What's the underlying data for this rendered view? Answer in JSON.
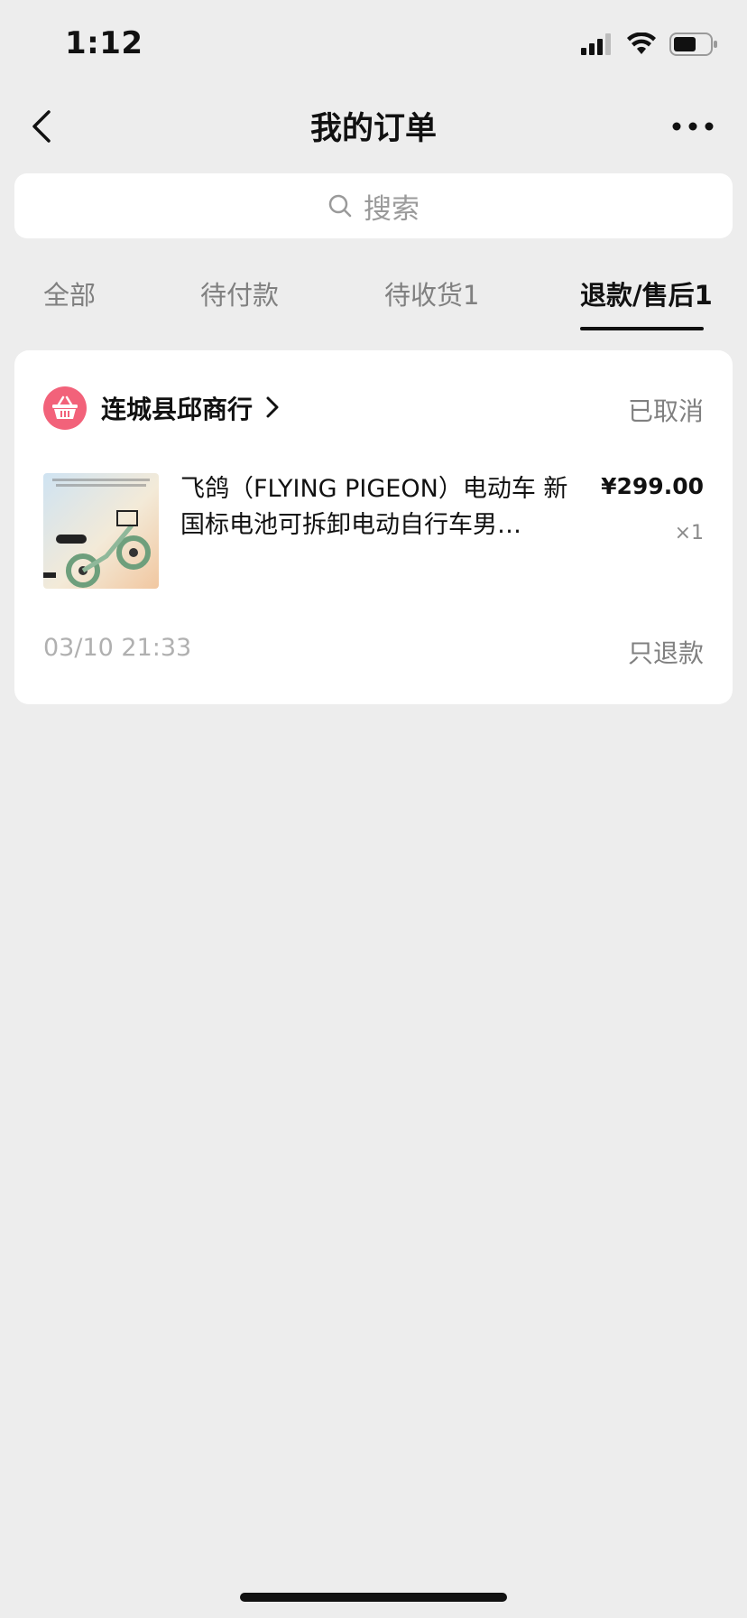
{
  "status_bar": {
    "time": "1:12"
  },
  "nav": {
    "title": "我的订单"
  },
  "search": {
    "placeholder": "搜索"
  },
  "tabs": [
    {
      "label": "全部",
      "active": false
    },
    {
      "label": "待付款",
      "active": false
    },
    {
      "label": "待收货1",
      "active": false
    },
    {
      "label": "退款/售后1",
      "active": true
    }
  ],
  "order": {
    "shop_name": "连城县邱商行",
    "status": "已取消",
    "product": {
      "title": "飞鸽（FLYING PIGEON）电动车 新国标电池可拆卸电动自行车男…",
      "price": "¥299.00",
      "quantity": "×1"
    },
    "time": "03/10 21:33",
    "refund_type": "只退款"
  },
  "colors": {
    "background": "#ededed",
    "card": "#ffffff",
    "shop_icon": "#f2627a",
    "muted_text": "#808080"
  }
}
